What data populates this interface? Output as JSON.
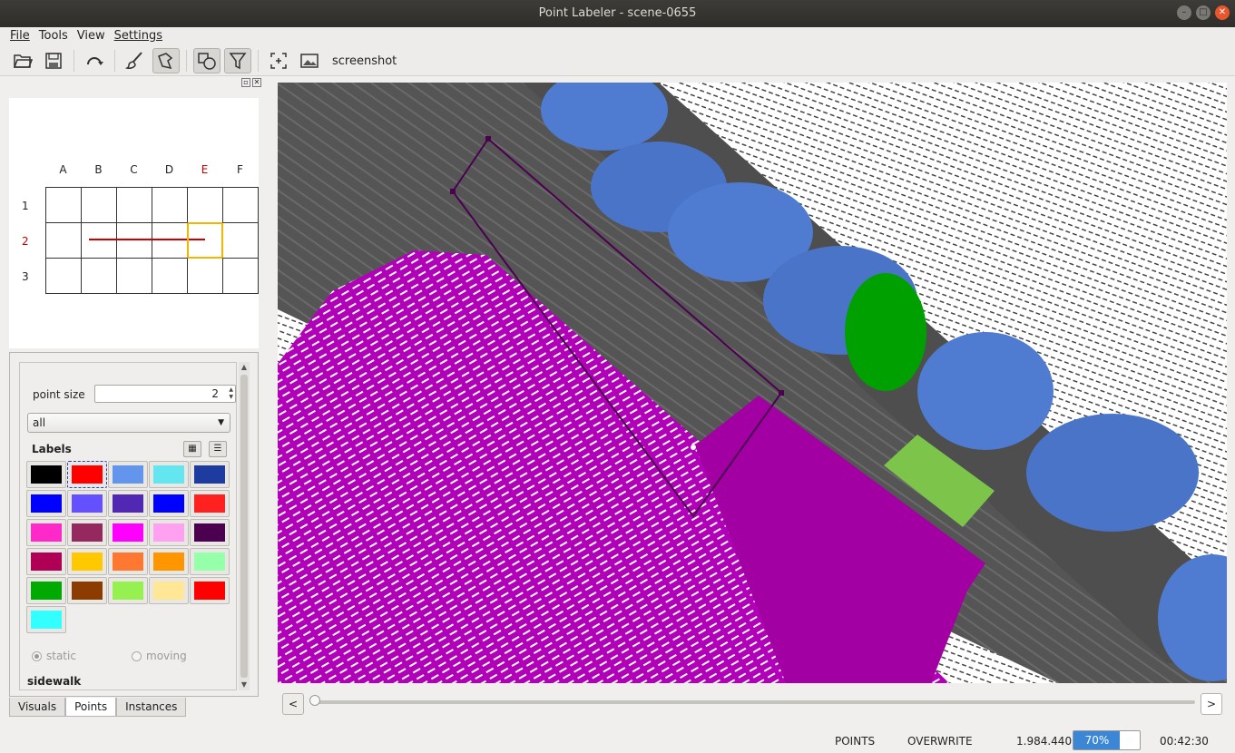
{
  "window": {
    "title": "Point Labeler - scene-0655"
  },
  "menu": [
    "File",
    "Tools",
    "View",
    "Settings"
  ],
  "toolbar": {
    "icons": [
      "open-folder-icon",
      "save-icon",
      "reload-icon",
      "brush-icon",
      "polygon-icon",
      "shapes-icon",
      "filter-icon",
      "crosshair-icon",
      "screenshot-icon"
    ],
    "screenshot_label": "screenshot"
  },
  "grid": {
    "columns": [
      "A",
      "B",
      "C",
      "D",
      "E",
      "F"
    ],
    "rows": [
      "1",
      "2",
      "3"
    ],
    "active_column": "E",
    "active_row": "2",
    "highlight_color": "#f4b400",
    "path_color": "#cc0000"
  },
  "points": {
    "point_size_label": "point size",
    "point_size_value": "2",
    "filter_value": "all",
    "labels_title": "Labels",
    "swatches": [
      "#000000",
      "#ff0000",
      "#6495ed",
      "#64e6f0",
      "#1e3ca0",
      "#0000ff",
      "#6450ff",
      "#5028b4",
      "#0000ff",
      "#ff2020",
      "#ff28c8",
      "#962860",
      "#ff00ff",
      "#ffa0f0",
      "#4b0050",
      "#af0055",
      "#ffc800",
      "#ff7832",
      "#ff9600",
      "#96ffaa",
      "#00aa00",
      "#8c3c00",
      "#96f050",
      "#ffe796",
      "#ff0000",
      "#32ffff"
    ],
    "selected_swatch": 1,
    "radio_static": "static",
    "radio_moving": "moving",
    "current_label": "sidewalk"
  },
  "tabs": [
    "Visuals",
    "Points",
    "Instances"
  ],
  "active_tab": "Points",
  "slider": {
    "prev": "<",
    "next": ">"
  },
  "status": {
    "mode": "POINTS",
    "write_mode": "OVERWRITE",
    "count": "1.984.440",
    "progress_text": "70%",
    "progress": 0.7,
    "time": "00:42:30"
  }
}
